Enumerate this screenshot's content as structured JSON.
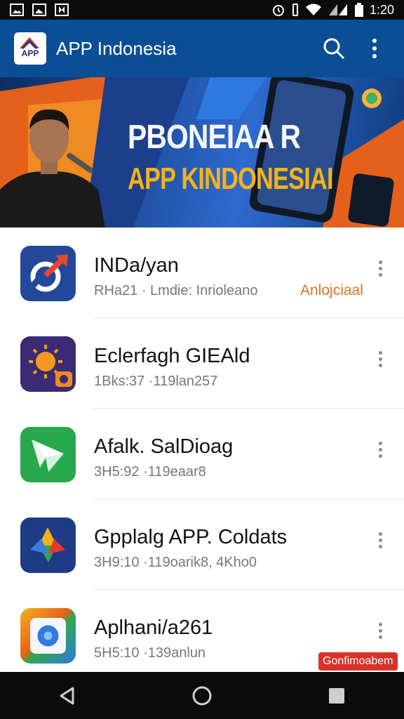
{
  "status_bar": {
    "time": "1:20",
    "left_icons": [
      "image-icon",
      "gallery-icon",
      "video-icon"
    ],
    "right_icons": [
      "alarm-icon",
      "vibrate-icon",
      "wifi-icon",
      "signal-icon",
      "battery-icon"
    ]
  },
  "app_bar": {
    "logo_text": "APP",
    "title": "APP Indonesia",
    "background": "#0a4f96",
    "actions": [
      "search-icon",
      "overflow-menu-icon"
    ]
  },
  "banner": {
    "line1": "PBONEIAA R",
    "line2": "APP KINDONESIAI"
  },
  "apps": [
    {
      "name": "INDa/yan",
      "meta": "RHa21 · Lmdie: Inrioleano",
      "tag": "Anlojciaal",
      "tag_style": "orange",
      "icon": "arrow-refresh-icon"
    },
    {
      "name": "Eclerfagh GIEAld",
      "meta": "1Bks:37 ·119lan257",
      "tag": "",
      "tag_style": "",
      "icon": "sun-camera-icon"
    },
    {
      "name": "Afalk. SalDioag",
      "meta": "3H5:92 ·119eaar8",
      "tag": "",
      "tag_style": "",
      "icon": "send-plane-icon"
    },
    {
      "name": "Gpplalg APP. Coldats",
      "meta": "3H9:10 ·119oarik8, 4Kho0",
      "tag": "",
      "tag_style": "",
      "icon": "star-triangle-icon"
    },
    {
      "name": "Aplhani/a261",
      "meta": "5H5:10 ·139anlun",
      "tag": "Gonfimoabem",
      "tag_style": "red",
      "icon": "camera-lens-icon"
    }
  ],
  "nav_bar": {
    "buttons": [
      "back-icon",
      "home-icon",
      "recents-icon"
    ]
  }
}
